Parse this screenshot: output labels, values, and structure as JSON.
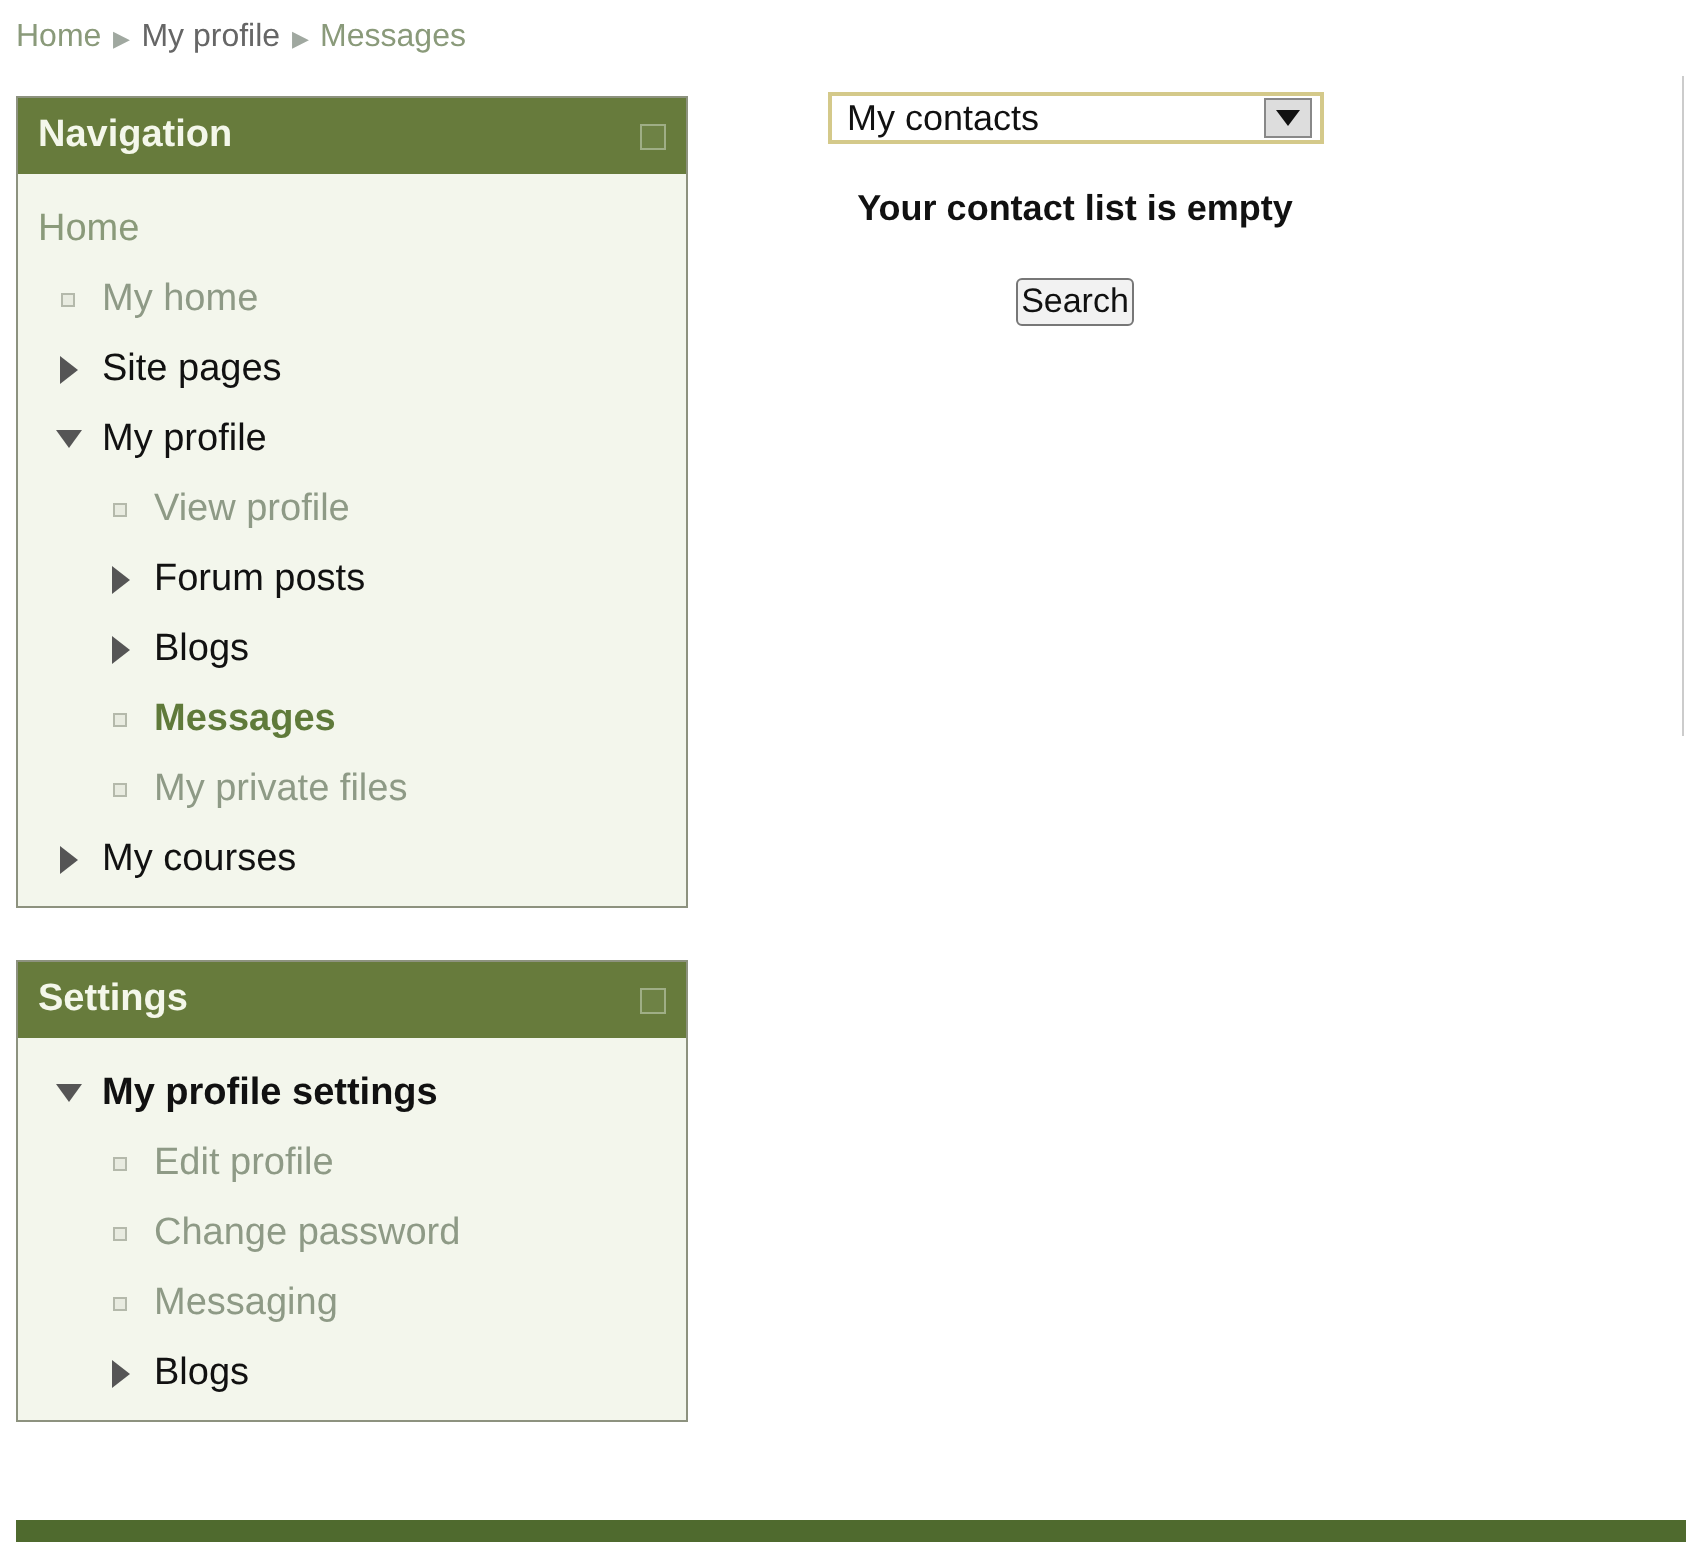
{
  "breadcrumb": [
    {
      "label": "Home",
      "separator": "▶"
    },
    {
      "label": "My profile",
      "separator": "▶"
    },
    {
      "label": "Messages"
    }
  ],
  "blocks": [
    {
      "title": "Navigation",
      "items": [
        {
          "label": "Home",
          "kind": "plain",
          "selected": false
        },
        {
          "label": "My home",
          "kind": "leaf",
          "selected": false
        },
        {
          "label": "Site pages",
          "kind": "branch",
          "expanded": false,
          "selected": false
        },
        {
          "label": "My profile",
          "kind": "branch",
          "expanded": true,
          "selected": false,
          "children": [
            {
              "label": "View profile",
              "kind": "leaf",
              "selected": false
            },
            {
              "label": "Forum posts",
              "kind": "branch",
              "expanded": false,
              "selected": false
            },
            {
              "label": "Blogs",
              "kind": "branch",
              "expanded": false,
              "selected": false
            },
            {
              "label": "Messages",
              "kind": "leaf",
              "selected": true
            },
            {
              "label": "My private files",
              "kind": "leaf",
              "selected": false
            }
          ]
        },
        {
          "label": "My courses",
          "kind": "branch",
          "expanded": false,
          "selected": false
        }
      ]
    },
    {
      "title": "Settings",
      "items": [
        {
          "label": "My profile settings",
          "kind": "section",
          "expanded": true,
          "selected": false,
          "children": [
            {
              "label": "Edit profile",
              "kind": "leaf",
              "selected": false
            },
            {
              "label": "Change password",
              "kind": "leaf",
              "selected": false
            },
            {
              "label": "Messaging",
              "kind": "leaf",
              "selected": false
            },
            {
              "label": "Blogs",
              "kind": "branch",
              "expanded": false,
              "selected": false
            }
          ]
        }
      ]
    }
  ],
  "contacts": {
    "dropdown": "My contacts",
    "message": "Your contact list is empty",
    "button": "Search"
  }
}
